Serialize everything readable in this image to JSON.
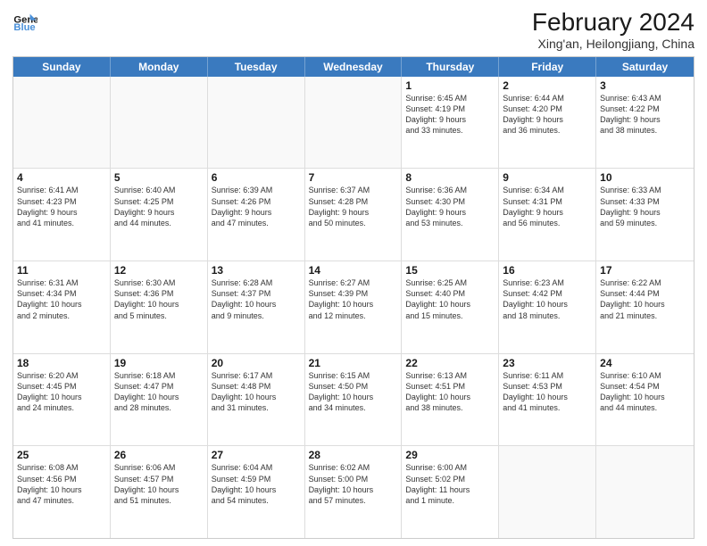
{
  "header": {
    "logo_general": "General",
    "logo_blue": "Blue",
    "month_year": "February 2024",
    "location": "Xing'an, Heilongjiang, China"
  },
  "weekdays": [
    "Sunday",
    "Monday",
    "Tuesday",
    "Wednesday",
    "Thursday",
    "Friday",
    "Saturday"
  ],
  "rows": [
    [
      {
        "day": "",
        "info": ""
      },
      {
        "day": "",
        "info": ""
      },
      {
        "day": "",
        "info": ""
      },
      {
        "day": "",
        "info": ""
      },
      {
        "day": "1",
        "info": "Sunrise: 6:45 AM\nSunset: 4:19 PM\nDaylight: 9 hours\nand 33 minutes."
      },
      {
        "day": "2",
        "info": "Sunrise: 6:44 AM\nSunset: 4:20 PM\nDaylight: 9 hours\nand 36 minutes."
      },
      {
        "day": "3",
        "info": "Sunrise: 6:43 AM\nSunset: 4:22 PM\nDaylight: 9 hours\nand 38 minutes."
      }
    ],
    [
      {
        "day": "4",
        "info": "Sunrise: 6:41 AM\nSunset: 4:23 PM\nDaylight: 9 hours\nand 41 minutes."
      },
      {
        "day": "5",
        "info": "Sunrise: 6:40 AM\nSunset: 4:25 PM\nDaylight: 9 hours\nand 44 minutes."
      },
      {
        "day": "6",
        "info": "Sunrise: 6:39 AM\nSunset: 4:26 PM\nDaylight: 9 hours\nand 47 minutes."
      },
      {
        "day": "7",
        "info": "Sunrise: 6:37 AM\nSunset: 4:28 PM\nDaylight: 9 hours\nand 50 minutes."
      },
      {
        "day": "8",
        "info": "Sunrise: 6:36 AM\nSunset: 4:30 PM\nDaylight: 9 hours\nand 53 minutes."
      },
      {
        "day": "9",
        "info": "Sunrise: 6:34 AM\nSunset: 4:31 PM\nDaylight: 9 hours\nand 56 minutes."
      },
      {
        "day": "10",
        "info": "Sunrise: 6:33 AM\nSunset: 4:33 PM\nDaylight: 9 hours\nand 59 minutes."
      }
    ],
    [
      {
        "day": "11",
        "info": "Sunrise: 6:31 AM\nSunset: 4:34 PM\nDaylight: 10 hours\nand 2 minutes."
      },
      {
        "day": "12",
        "info": "Sunrise: 6:30 AM\nSunset: 4:36 PM\nDaylight: 10 hours\nand 5 minutes."
      },
      {
        "day": "13",
        "info": "Sunrise: 6:28 AM\nSunset: 4:37 PM\nDaylight: 10 hours\nand 9 minutes."
      },
      {
        "day": "14",
        "info": "Sunrise: 6:27 AM\nSunset: 4:39 PM\nDaylight: 10 hours\nand 12 minutes."
      },
      {
        "day": "15",
        "info": "Sunrise: 6:25 AM\nSunset: 4:40 PM\nDaylight: 10 hours\nand 15 minutes."
      },
      {
        "day": "16",
        "info": "Sunrise: 6:23 AM\nSunset: 4:42 PM\nDaylight: 10 hours\nand 18 minutes."
      },
      {
        "day": "17",
        "info": "Sunrise: 6:22 AM\nSunset: 4:44 PM\nDaylight: 10 hours\nand 21 minutes."
      }
    ],
    [
      {
        "day": "18",
        "info": "Sunrise: 6:20 AM\nSunset: 4:45 PM\nDaylight: 10 hours\nand 24 minutes."
      },
      {
        "day": "19",
        "info": "Sunrise: 6:18 AM\nSunset: 4:47 PM\nDaylight: 10 hours\nand 28 minutes."
      },
      {
        "day": "20",
        "info": "Sunrise: 6:17 AM\nSunset: 4:48 PM\nDaylight: 10 hours\nand 31 minutes."
      },
      {
        "day": "21",
        "info": "Sunrise: 6:15 AM\nSunset: 4:50 PM\nDaylight: 10 hours\nand 34 minutes."
      },
      {
        "day": "22",
        "info": "Sunrise: 6:13 AM\nSunset: 4:51 PM\nDaylight: 10 hours\nand 38 minutes."
      },
      {
        "day": "23",
        "info": "Sunrise: 6:11 AM\nSunset: 4:53 PM\nDaylight: 10 hours\nand 41 minutes."
      },
      {
        "day": "24",
        "info": "Sunrise: 6:10 AM\nSunset: 4:54 PM\nDaylight: 10 hours\nand 44 minutes."
      }
    ],
    [
      {
        "day": "25",
        "info": "Sunrise: 6:08 AM\nSunset: 4:56 PM\nDaylight: 10 hours\nand 47 minutes."
      },
      {
        "day": "26",
        "info": "Sunrise: 6:06 AM\nSunset: 4:57 PM\nDaylight: 10 hours\nand 51 minutes."
      },
      {
        "day": "27",
        "info": "Sunrise: 6:04 AM\nSunset: 4:59 PM\nDaylight: 10 hours\nand 54 minutes."
      },
      {
        "day": "28",
        "info": "Sunrise: 6:02 AM\nSunset: 5:00 PM\nDaylight: 10 hours\nand 57 minutes."
      },
      {
        "day": "29",
        "info": "Sunrise: 6:00 AM\nSunset: 5:02 PM\nDaylight: 11 hours\nand 1 minute."
      },
      {
        "day": "",
        "info": ""
      },
      {
        "day": "",
        "info": ""
      }
    ]
  ]
}
